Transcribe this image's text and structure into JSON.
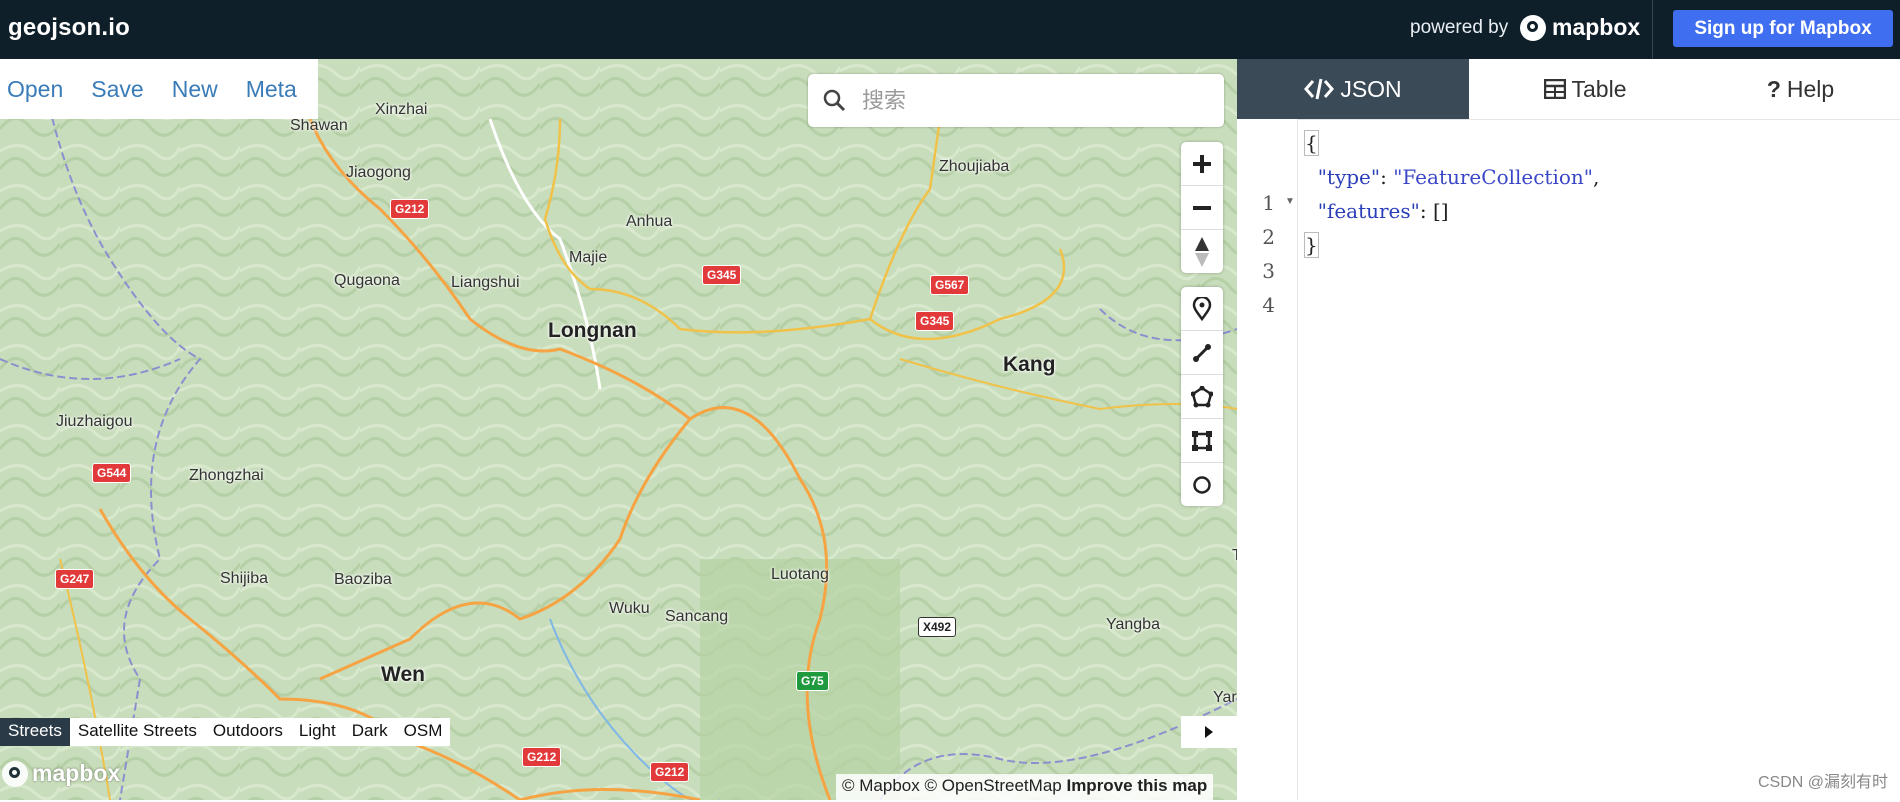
{
  "topbar": {
    "logo": "geojson.io",
    "powered_by": "powered by",
    "mapbox_wordmark": "mapbox",
    "signup_label": "Sign up for Mapbox"
  },
  "menu": [
    "Open",
    "Save",
    "New",
    "Meta"
  ],
  "search": {
    "placeholder": "搜索"
  },
  "map": {
    "places": [
      "Xinzhai",
      "Shawan",
      "Jiaogong",
      "Anhua",
      "Majie",
      "Qugaona",
      "Liangshui",
      "Longnan",
      "Zhoujiaba",
      "Kang",
      "Jiuzhaigou",
      "Zhongzhai",
      "Shijiba",
      "Baoziba",
      "Wuku",
      "Sancang",
      "Luotang",
      "Yangba",
      "Wen",
      "Yar",
      "T"
    ],
    "shields": [
      "G212",
      "G345",
      "G345",
      "G567",
      "G544",
      "G247",
      "X492",
      "G75",
      "G212",
      "G212"
    ],
    "styles": [
      "Streets",
      "Satellite Streets",
      "Outdoors",
      "Light",
      "Dark",
      "OSM"
    ],
    "active_style": "Streets",
    "logo": "mapbox",
    "attribution_mapbox": "© Mapbox",
    "attribution_osm": "© OpenStreetMap",
    "attribution_improve": "Improve this map"
  },
  "controls": {
    "zoom": [
      "zoom-in-icon",
      "zoom-out-icon",
      "compass-icon"
    ],
    "draw": [
      "marker-icon",
      "line-icon",
      "polygon-icon",
      "rectangle-icon",
      "circle-icon"
    ]
  },
  "panel": {
    "tabs": [
      {
        "label": "JSON",
        "icon": "code-icon",
        "active": true
      },
      {
        "label": "Table",
        "icon": "table-icon",
        "active": false
      },
      {
        "label": "Help",
        "icon": "question-icon",
        "active": false
      }
    ],
    "line_numbers": [
      "1",
      "2",
      "3",
      "4"
    ],
    "code": {
      "open_brace": "{",
      "type_key": "\"type\"",
      "type_value": "\"FeatureCollection\"",
      "features_key": "\"features\"",
      "features_value": "[]",
      "close_brace": "}"
    },
    "watermark": "CSDN @漏刻有时"
  },
  "colors": {
    "topbar": "#0f1f2a",
    "signup": "#3f6ef0",
    "link": "#3a7cb8",
    "active_tab": "#3a4a57"
  }
}
